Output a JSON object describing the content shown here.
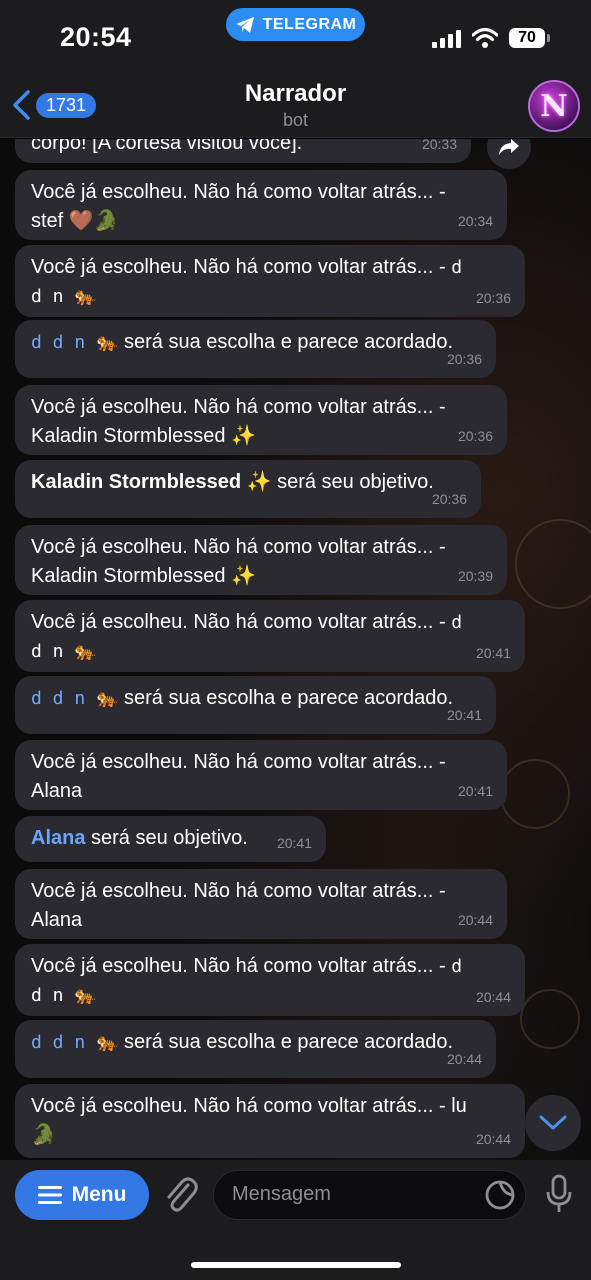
{
  "status_bar": {
    "time": "20:54",
    "app_pill": "TELEGRAM",
    "battery": "70"
  },
  "header": {
    "back_count": "1731",
    "title": "Narrador",
    "subtitle": "bot",
    "avatar_letter": "N"
  },
  "messages": [
    {
      "text": "corpo! [A cortesã visitou você].",
      "time": "20:33"
    },
    {
      "text": "Você já escolheu. Não há como voltar atrás... -",
      "text2": "stef 🤎🐊",
      "time": "20:34"
    },
    {
      "text": "Você já escolheu. Não há como voltar atrás... -",
      "tail": "d",
      "text2": "d n 🐅",
      "time": "20:36"
    },
    {
      "mono": "d d n 🐅",
      "text": " será sua escolha e parece acordado.",
      "time": "20:36"
    },
    {
      "text": "Você já escolheu. Não há como voltar atrás... -",
      "text2": "Kaladin Stormblessed ✨",
      "time": "20:36"
    },
    {
      "bold": "Kaladin Stormblessed ✨",
      "text": " será seu objetivo.",
      "time": "20:36"
    },
    {
      "text": "Você já escolheu. Não há como voltar atrás... -",
      "text2": "Kaladin Stormblessed ✨",
      "time": "20:39"
    },
    {
      "text": "Você já escolheu. Não há como voltar atrás... -",
      "tail": "d",
      "text2": "d n 🐅",
      "time": "20:41"
    },
    {
      "mono": "d d n 🐅",
      "text": " será sua escolha e parece acordado.",
      "time": "20:41"
    },
    {
      "text": "Você já escolheu. Não há como voltar atrás... -",
      "text2": "Alana",
      "time": "20:41"
    },
    {
      "link": "Alana",
      "text": " será seu objetivo.",
      "time": "20:41"
    },
    {
      "text": "Você já escolheu. Não há como voltar atrás... -",
      "text2": "Alana",
      "time": "20:44"
    },
    {
      "text": "Você já escolheu. Não há como voltar atrás... -",
      "tail": "d",
      "text2": "d n 🐅",
      "time": "20:44"
    },
    {
      "mono": "d d n 🐅",
      "text": " será sua escolha e parece acordado.",
      "time": "20:44"
    },
    {
      "text": "Você já escolheu. Não há como voltar atrás... - lu",
      "text2": "🐊",
      "time": "20:44"
    }
  ],
  "input_bar": {
    "menu_label": "Menu",
    "placeholder": "Mensagem"
  },
  "colors": {
    "accent": "#3478e5",
    "bubble": "#2a2a30",
    "link": "#6aa6ff"
  }
}
